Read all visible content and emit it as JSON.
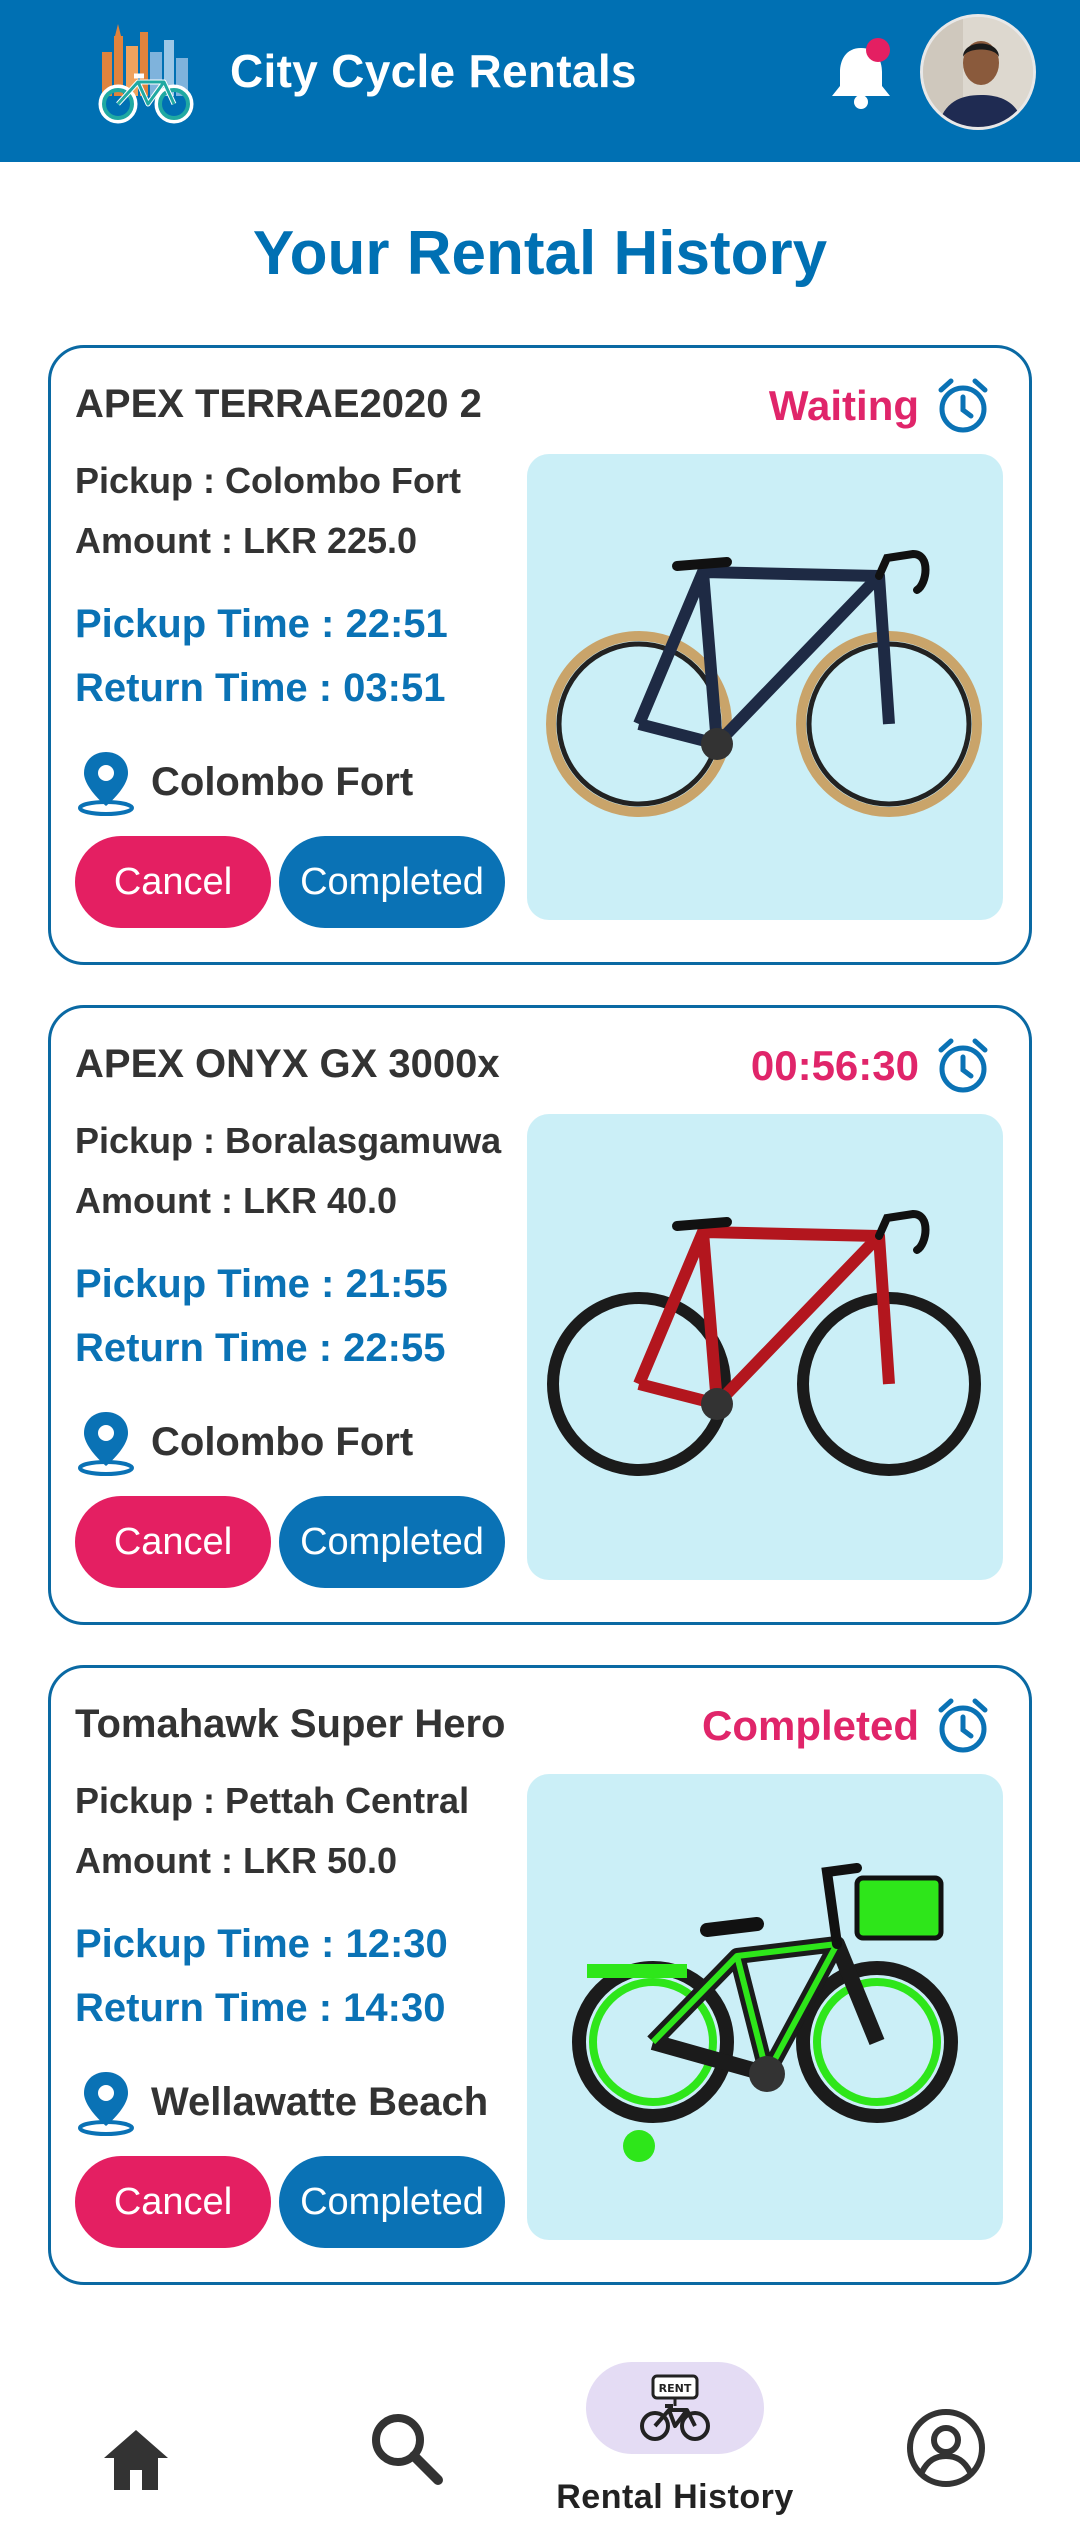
{
  "app": {
    "title": "City Cycle Rentals",
    "notification_has_badge": true,
    "colors": {
      "primary": "#0070b3",
      "accent": "#e41f62",
      "card_image_bg": "#cbeff7"
    }
  },
  "page": {
    "title": "Your Rental History"
  },
  "rentals": [
    {
      "name": "APEX TERRAE2020 2",
      "status": "Waiting",
      "pickup": "Pickup : Colombo Fort",
      "amount": "Amount : LKR 225.0",
      "pickup_time": "Pickup Time : 22:51",
      "return_time": "Return Time : 03:51",
      "location": "Colombo Fort",
      "cancel_label": "Cancel",
      "completed_label": "Completed",
      "bike_color": "#1e2a44"
    },
    {
      "name": "APEX ONYX GX 3000x",
      "status": "00:56:30",
      "pickup": "Pickup : Boralasgamuwa",
      "amount": "Amount : LKR 40.0",
      "pickup_time": "Pickup Time : 21:55",
      "return_time": "Return Time : 22:55",
      "location": "Colombo Fort",
      "cancel_label": "Cancel",
      "completed_label": "Completed",
      "bike_color": "#b3161e"
    },
    {
      "name": "Tomahawk Super Hero",
      "status": "Completed",
      "pickup": "Pickup : Pettah Central",
      "amount": "Amount : LKR 50.0",
      "pickup_time": "Pickup Time : 12:30",
      "return_time": "Return Time : 14:30",
      "location": "Wellawatte Beach",
      "cancel_label": "Cancel",
      "completed_label": "Completed",
      "bike_color": "#2ee61a"
    }
  ],
  "nav": {
    "items": [
      {
        "id": "home",
        "icon": "home-icon"
      },
      {
        "id": "search",
        "icon": "search-icon"
      },
      {
        "id": "rental-history",
        "icon": "rent-bike-icon",
        "label": "Rental History",
        "active": true,
        "icon_text": "RENT"
      },
      {
        "id": "profile",
        "icon": "profile-icon"
      }
    ]
  }
}
